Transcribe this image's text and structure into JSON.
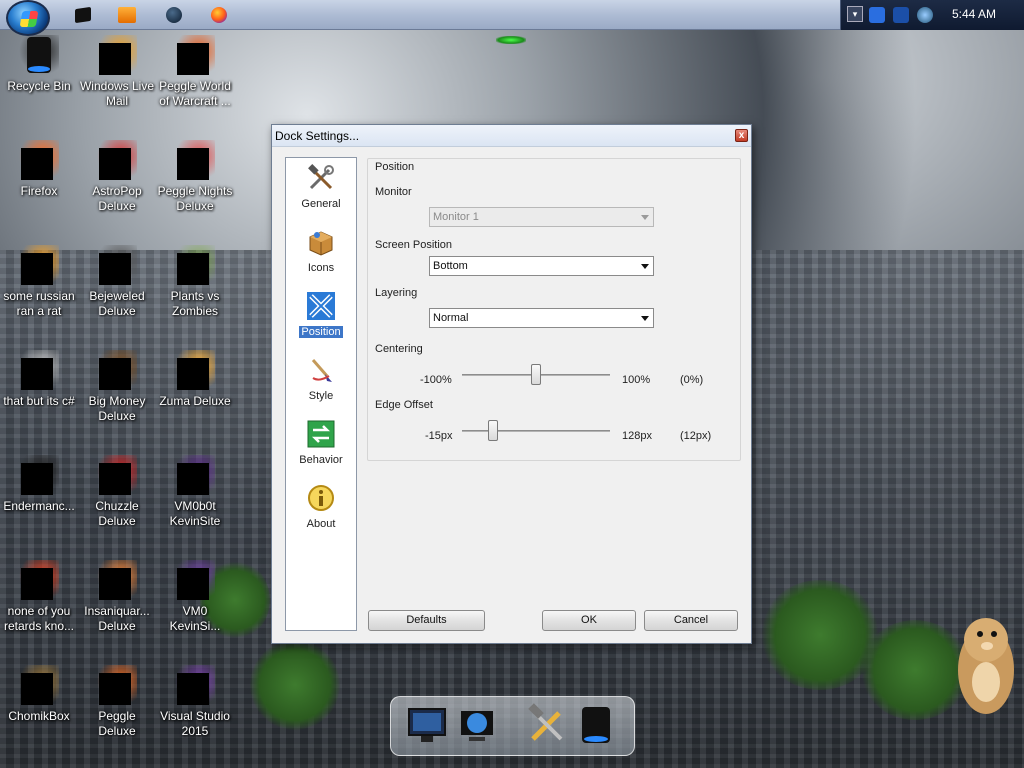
{
  "taskbar": {
    "clock": "5:44 AM",
    "pinned": [
      "app-dark-icon",
      "media-player-icon",
      "globe-icon",
      "firefox-icon"
    ]
  },
  "desktop_icons": [
    {
      "name": "recycle-bin",
      "label": "Recycle Bin"
    },
    {
      "name": "windows-live-mail",
      "label": "Windows Live Mail"
    },
    {
      "name": "peggle-world-of-warcraft",
      "label": "Peggle World of Warcraft ..."
    },
    {
      "name": "firefox",
      "label": "Firefox"
    },
    {
      "name": "astropop-deluxe",
      "label": "AstroPop Deluxe"
    },
    {
      "name": "peggle-nights-deluxe",
      "label": "Peggle Nights Deluxe"
    },
    {
      "name": "some-russian",
      "label": "some russian ran a rat"
    },
    {
      "name": "bejeweled-deluxe",
      "label": "Bejeweled Deluxe"
    },
    {
      "name": "plants-vs-zombies",
      "label": "Plants vs Zombies"
    },
    {
      "name": "that-but-its-c",
      "label": "that but its c#"
    },
    {
      "name": "big-money-deluxe",
      "label": "Big Money Deluxe"
    },
    {
      "name": "zuma-deluxe",
      "label": "Zuma Deluxe"
    },
    {
      "name": "endermanc",
      "label": "Endermanc..."
    },
    {
      "name": "chuzzle-deluxe",
      "label": "Chuzzle Deluxe"
    },
    {
      "name": "vm0b0t-kevin-site",
      "label": "VM0b0t KevinSite"
    },
    {
      "name": "none-of-you",
      "label": "none of you retards kno..."
    },
    {
      "name": "insaniquarium-deluxe",
      "label": "Insaniquar... Deluxe"
    },
    {
      "name": "vm0-kevinsi",
      "label": "VM0 KevinSi..."
    },
    {
      "name": "chomikbox",
      "label": "ChomikBox"
    },
    {
      "name": "peggle-deluxe",
      "label": "Peggle Deluxe"
    },
    {
      "name": "visual-studio-2015",
      "label": "Visual Studio 2015"
    }
  ],
  "dialog": {
    "title": "Dock Settings...",
    "close": "x",
    "sidebar": [
      {
        "label": "General",
        "icon": "tools-icon"
      },
      {
        "label": "Icons",
        "icon": "box-icon"
      },
      {
        "label": "Position",
        "icon": "move-arrows-icon",
        "active": true
      },
      {
        "label": "Style",
        "icon": "paintbrush-icon"
      },
      {
        "label": "Behavior",
        "icon": "arrows-switch-icon"
      },
      {
        "label": "About",
        "icon": "info-icon"
      }
    ],
    "position": {
      "group_title": "Position",
      "monitor_label": "Monitor",
      "monitor_value": "Monitor 1",
      "screen_position_label": "Screen Position",
      "screen_position_value": "Bottom",
      "layering_label": "Layering",
      "layering_value": "Normal",
      "centering_label": "Centering",
      "centering_min": "-100%",
      "centering_max": "100%",
      "centering_value": "(0%)",
      "centering_fraction": 0.5,
      "edge_offset_label": "Edge Offset",
      "edge_offset_min": "-15px",
      "edge_offset_max": "128px",
      "edge_offset_value": "(12px)",
      "edge_offset_fraction": 0.19
    },
    "buttons": {
      "defaults": "Defaults",
      "ok": "OK",
      "cancel": "Cancel"
    }
  },
  "colors": {
    "accent": "#3d76c8",
    "taskbar": "#aebcd4",
    "dialog_bg": "#f0f0f0"
  }
}
